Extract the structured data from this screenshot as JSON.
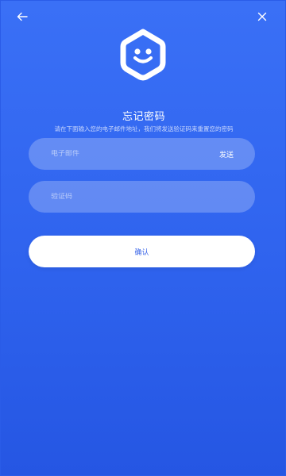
{
  "header": {
    "back_icon": "arrow-left-icon",
    "close_icon": "close-icon"
  },
  "logo": {
    "icon": "shield-smile-icon"
  },
  "title": "忘记密码",
  "subtitle": "请在下面输入您的电子邮件地址，我们将发送验证码来重置您的密码",
  "email_field": {
    "value": "",
    "placeholder": "电子邮件",
    "send_label": "发送"
  },
  "code_field": {
    "value": "",
    "placeholder": "验证码"
  },
  "confirm_button": {
    "label": "确认"
  },
  "colors": {
    "background_top": "#3a70f6",
    "background_bottom": "#2556e3",
    "button_bg": "#ffffff",
    "button_text": "#3a65e8"
  }
}
